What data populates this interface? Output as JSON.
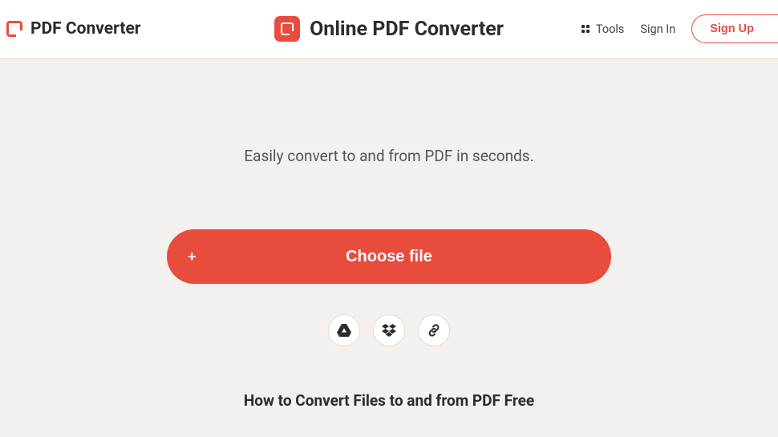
{
  "header": {
    "brand": "PDF Converter",
    "title": "Online PDF Converter",
    "tools_label": "Tools",
    "signin_label": "Sign In",
    "signup_label": "Sign Up"
  },
  "main": {
    "subtitle": "Easily convert to and from PDF in seconds.",
    "choose_file_label": "Choose file",
    "howto_title": "How to Convert Files to and from PDF Free"
  }
}
